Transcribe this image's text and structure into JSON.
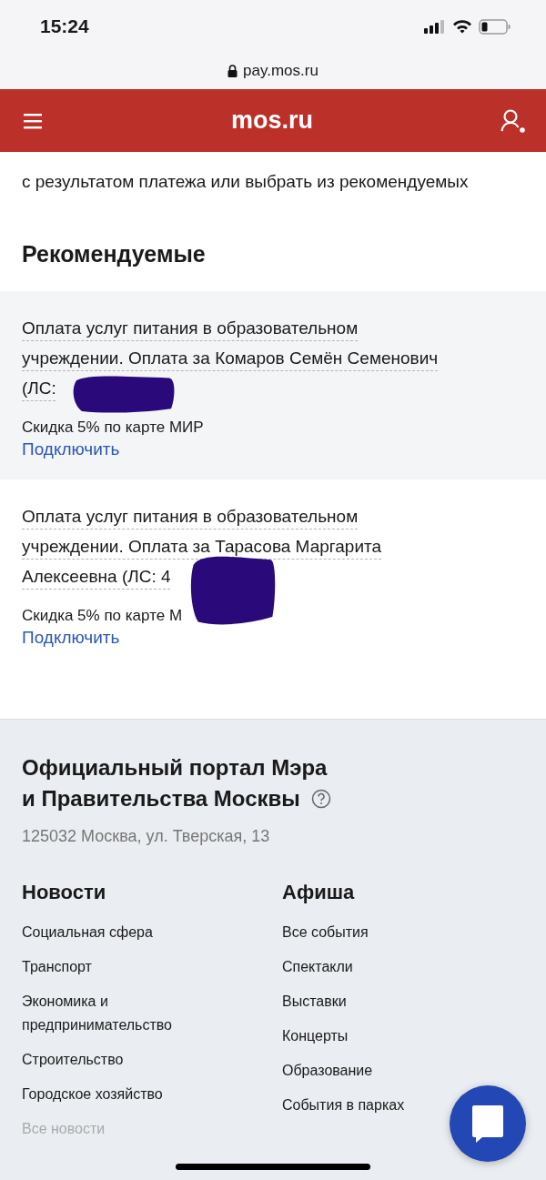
{
  "status_bar": {
    "time": "15:24"
  },
  "browser": {
    "url": "pay.mos.ru"
  },
  "header": {
    "title": "mos.ru"
  },
  "intro_text": "с результатом платежа или выбрать из рекомендуемых",
  "recommended": {
    "title": "Рекомендуемые",
    "items": [
      {
        "description": "Оплата услуг питания в образовательном учреждении. Оплата за Комаров Семён Семенович (ЛС:",
        "discount": "Скидка 5% по карте МИР",
        "action": "Подключить"
      },
      {
        "description": "Оплата услуг питания в образовательном учреждении. Оплата за Тарасова Маргарита Алексеевна (ЛС: 4",
        "discount": "Скидка 5% по карте М",
        "action": "Подключить"
      }
    ]
  },
  "footer": {
    "title_lines": [
      "Официальный портал Мэра",
      "и Правительства Москвы"
    ],
    "address": "125032 Москва, ул. Тверская, 13",
    "columns": [
      {
        "heading": "Новости",
        "links": [
          "Социальная сфера",
          "Транспорт",
          "Экономика и предпринимательство",
          "Строительство",
          "Городское хозяйство"
        ],
        "more": "Все новости"
      },
      {
        "heading": "Афиша",
        "links": [
          "Все события",
          "Спектакли",
          "Выставки",
          "Концерты",
          "Образование",
          "События в парках"
        ]
      }
    ]
  }
}
